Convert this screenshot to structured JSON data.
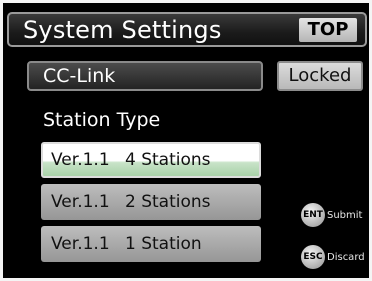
{
  "header": {
    "title": "System Settings",
    "top_button": "TOP"
  },
  "network": {
    "value": "CC-Link",
    "lock_status": "Locked"
  },
  "station_type": {
    "label": "Station Type",
    "selected_index": 0,
    "options": [
      {
        "version": "Ver.1.1",
        "stations": "4 Stations"
      },
      {
        "version": "Ver.1.1",
        "stations": "2 Stations"
      },
      {
        "version": "Ver.1.1",
        "stations": "1 Station"
      }
    ]
  },
  "keys": {
    "submit": {
      "icon_text": "ENT",
      "label": "Submit"
    },
    "discard": {
      "icon_text": "ESC",
      "label": "Discard"
    }
  },
  "colors": {
    "selected_highlight": "#a9d2a9",
    "screen_background": "#000000",
    "button_gray": "#b9b9b9"
  }
}
